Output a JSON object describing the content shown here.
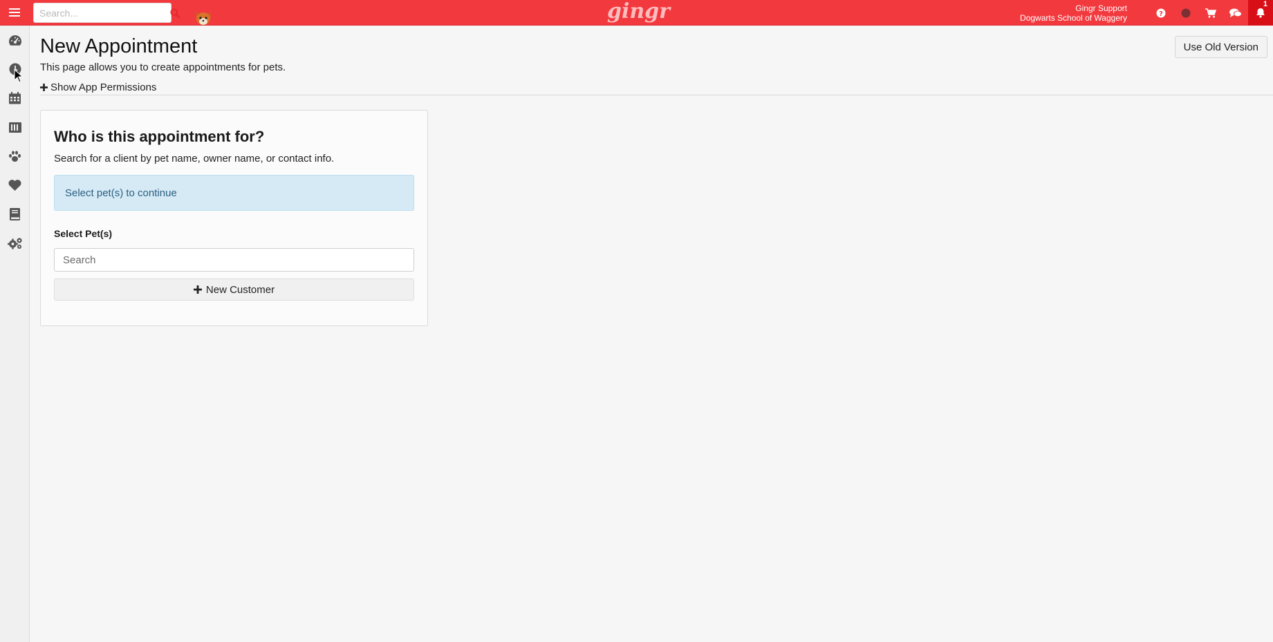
{
  "topbar": {
    "search_placeholder": "Search...",
    "logo_text": "gingr",
    "user_name": "Gingr Support",
    "business_name": "Dogwarts School of Waggery",
    "notification_count": "1",
    "brand_color": "#f2393e"
  },
  "sidebar": {
    "items": [
      {
        "icon": "dashboard-icon"
      },
      {
        "icon": "clock-icon"
      },
      {
        "icon": "calendar-icon"
      },
      {
        "icon": "kennel-icon"
      },
      {
        "icon": "paw-icon"
      },
      {
        "icon": "heart-icon"
      },
      {
        "icon": "book-icon"
      },
      {
        "icon": "cogs-icon"
      }
    ]
  },
  "main": {
    "title": "New Appointment",
    "description": "This page allows you to create appointments for pets.",
    "permissions_toggle": "Show App Permissions",
    "old_version_label": "Use Old Version",
    "card": {
      "title": "Who is this appointment for?",
      "subtitle": "Search for a client by pet name, owner name, or contact info.",
      "alert": "Select pet(s) to continue",
      "field_label": "Select Pet(s)",
      "search_placeholder": "Search",
      "new_customer_label": "New Customer"
    }
  }
}
